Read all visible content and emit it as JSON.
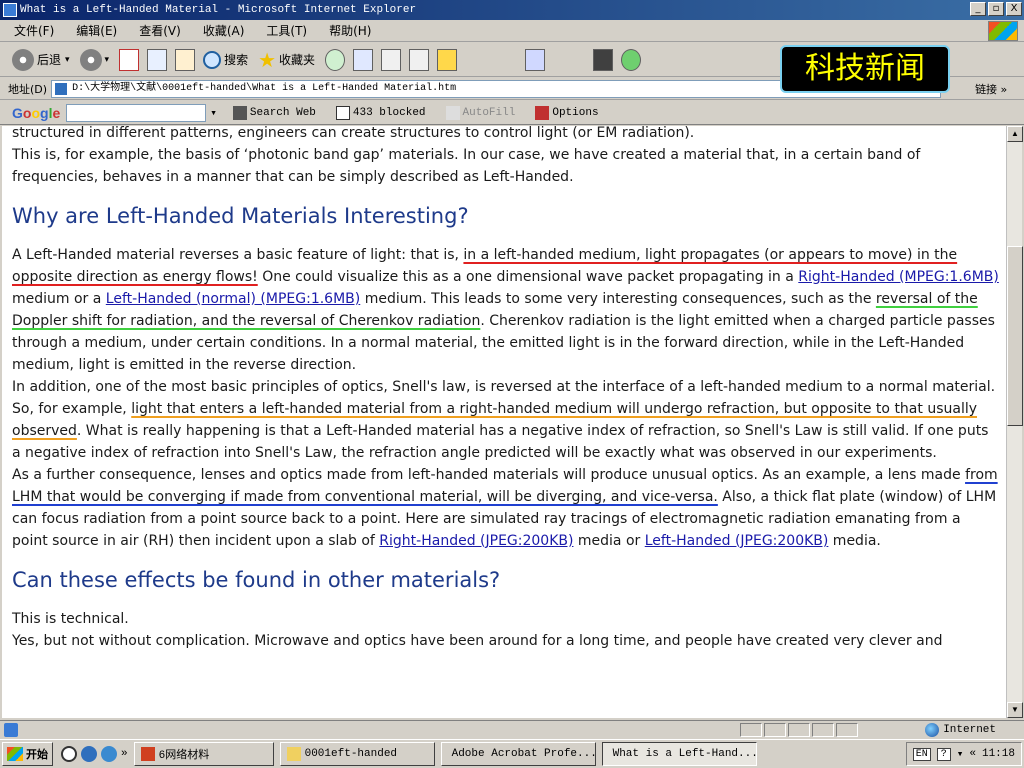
{
  "window": {
    "title": "What is a Left-Handed Material - Microsoft Internet Explorer",
    "controls": [
      "_",
      "▫",
      "X"
    ]
  },
  "menu": [
    "文件(F)",
    "编辑(E)",
    "查看(V)",
    "收藏(A)",
    "工具(T)",
    "帮助(H)"
  ],
  "toolbar": {
    "back": "后退",
    "search": "搜索",
    "favorites": "收藏夹"
  },
  "overlay_badge": "科技新闻",
  "address": {
    "label": "地址(D)",
    "value": "D:\\大学物理\\文献\\0001eft-handed\\What is a Left-Handed Material.htm",
    "links": "链接 »"
  },
  "google_bar": {
    "logo": "Google",
    "search_web": "Search Web",
    "blocked": "433 blocked",
    "autofill": "AutoFill",
    "options": "Options"
  },
  "article": {
    "intro_1": "structured in different patterns, engineers can create structures to control light (or EM radiation).",
    "intro_2": "This is, for example, the basis of ‘photonic band gap’ materials. In our case, we have created a material that, in a certain band of frequencies, behaves in a manner that can be simply described as Left-Handed.",
    "h_interesting": "Why are Left-Handed Materials Interesting?",
    "p1_a": "A Left-Handed material reverses a basic feature of light: that is, ",
    "p1_red": "in a left-handed medium, light propagates (or appears to move) in the opposite direction as energy flows!",
    "p1_b": " One could visualize this as a one dimensional wave packet propagating in a ",
    "p1_link1": "Right-Handed (MPEG:1.6MB)",
    "p1_c": " medium or a ",
    "p1_link2": "Left-Handed (normal) (MPEG:1.6MB)",
    "p1_d": " medium. This leads to some very interesting consequences, such as the ",
    "p1_green": "reversal of the Doppler shift for radiation, and the reversal of Cherenkov radiation",
    "p1_e": ". Cherenkov radiation is the light emitted when a charged particle passes through a medium, under certain conditions. In a normal material, the emitted light is in the forward direction, while in the Left-Handed medium, light is emitted in the reverse direction.",
    "p2_a": "In addition, one of the most basic principles of optics, Snell's law, is reversed at the interface of a left-handed medium to a normal material. So, for example, ",
    "p2_orange": "light that enters a left-handed material from a right-handed medium will undergo refraction, but opposite to that usually observed",
    "p2_b": ". What is really happening is that a Left-Handed material has a negative index of refraction, so Snell's Law is still valid. If one puts a negative index of refraction into Snell's Law, the refraction angle predicted will be exactly what was observed in our experiments.",
    "p3_a": "As a further consequence, lenses and optics made from left-handed materials will produce unusual optics. As an example, a lens made ",
    "p3_blue": "from LHM that would be converging if made from conventional material, will be diverging, and vice-versa.",
    "p3_b": " Also, a thick flat plate (window) of LHM can focus radiation from a point source back to a point. Here are simulated ray tracings of electromagnetic radiation emanating from a point source in air (RH) then incident upon a slab of ",
    "p3_link1": "Right-Handed (JPEG:200KB)",
    "p3_c": " media or ",
    "p3_link2": "Left-Handed (JPEG:200KB)",
    "p3_d": " media.",
    "h_other": "Can these effects be found in other materials?",
    "p4": "This is technical.",
    "p5": "Yes, but not without complication. Microwave and optics have been around for a long time, and people have created very clever and"
  },
  "status": {
    "zone": "Internet"
  },
  "taskbar": {
    "start": "开始",
    "tasks": [
      "6网络材料",
      "0001eft-handed",
      "Adobe Acrobat Profe...",
      "What is a Left-Hand..."
    ],
    "lang": "EN",
    "clock": "11:18"
  }
}
